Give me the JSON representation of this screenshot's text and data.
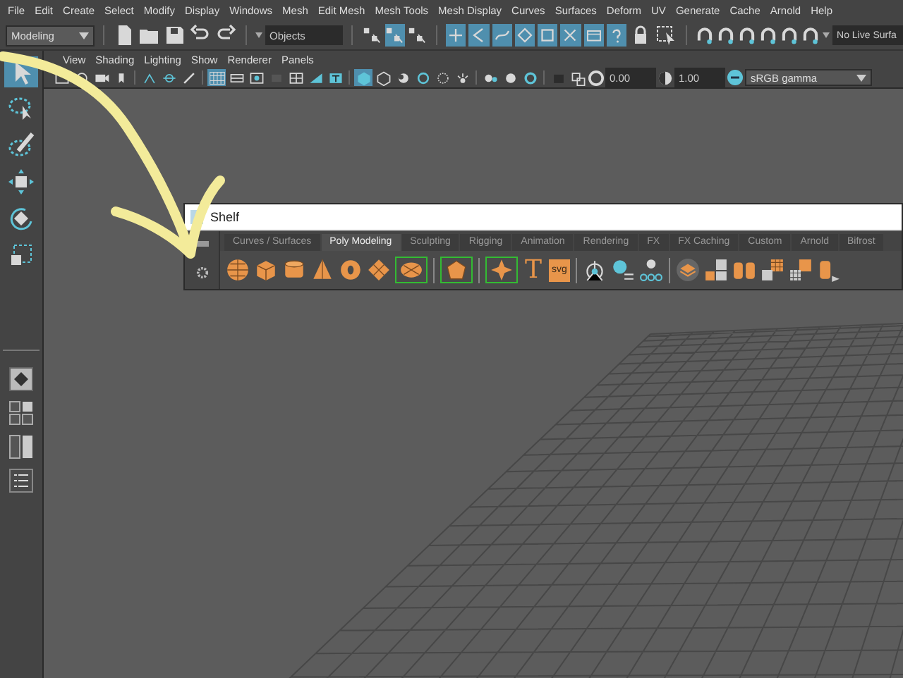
{
  "menu_bar": [
    "File",
    "Edit",
    "Create",
    "Select",
    "Modify",
    "Display",
    "Windows",
    "Mesh",
    "Edit Mesh",
    "Mesh Tools",
    "Mesh Display",
    "Curves",
    "Surfaces",
    "Deform",
    "UV",
    "Generate",
    "Cache",
    "Arnold",
    "Help"
  ],
  "status_line": {
    "menu_set": "Modeling",
    "selection_mode": "Objects",
    "selection_buttons": [
      {
        "selected": false
      },
      {
        "selected": true
      },
      {
        "selected": false
      }
    ],
    "mask_buttons": [
      {
        "selected": true
      },
      {
        "selected": true
      },
      {
        "selected": true
      },
      {
        "selected": true
      },
      {
        "selected": true
      },
      {
        "selected": true
      },
      {
        "selected": true
      },
      {
        "selected": true
      }
    ],
    "live_surface": "No Live Surfa"
  },
  "toolbox": [
    {
      "selected": true
    },
    {
      "selected": false
    },
    {
      "selected": false
    },
    {
      "selected": false
    },
    {
      "selected": false
    },
    {
      "selected": false
    }
  ],
  "viewport": {
    "menus": [
      "View",
      "Shading",
      "Lighting",
      "Show",
      "Renderer",
      "Panels"
    ],
    "buttons": [
      {
        "selected": false
      },
      {
        "selected": false
      },
      {
        "selected": false
      },
      {
        "selected": false
      },
      {
        "selected": false
      },
      {
        "selected": false
      },
      {
        "selected": false
      },
      {
        "selected": true
      },
      {
        "selected": false
      },
      {
        "selected": false
      },
      {
        "selected": false
      },
      {
        "selected": false
      },
      {
        "selected": false
      },
      {
        "selected": false
      },
      {
        "selected": true
      },
      {
        "selected": false
      },
      {
        "selected": false
      },
      {
        "selected": false
      },
      {
        "selected": false
      },
      {
        "selected": false
      },
      {
        "selected": false
      },
      {
        "selected": false
      },
      {
        "selected": false
      },
      {
        "selected": false
      },
      {
        "selected": false
      }
    ],
    "exposure": "0.00",
    "gamma": "1.00",
    "color_space": "sRGB gamma"
  },
  "shelf": {
    "title": "Shelf",
    "tabs": [
      {
        "label": "Curves / Surfaces",
        "selected": false
      },
      {
        "label": "Poly Modeling",
        "selected": true
      },
      {
        "label": "Sculpting",
        "selected": false
      },
      {
        "label": "Rigging",
        "selected": false
      },
      {
        "label": "Animation",
        "selected": false
      },
      {
        "label": "Rendering",
        "selected": false
      },
      {
        "label": "FX",
        "selected": false
      },
      {
        "label": "FX Caching",
        "selected": false
      },
      {
        "label": "Custom",
        "selected": false
      },
      {
        "label": "Arnold",
        "selected": false
      },
      {
        "label": "Bifrost",
        "selected": false
      }
    ],
    "text_tool": "T",
    "svg_tool": "svg"
  }
}
